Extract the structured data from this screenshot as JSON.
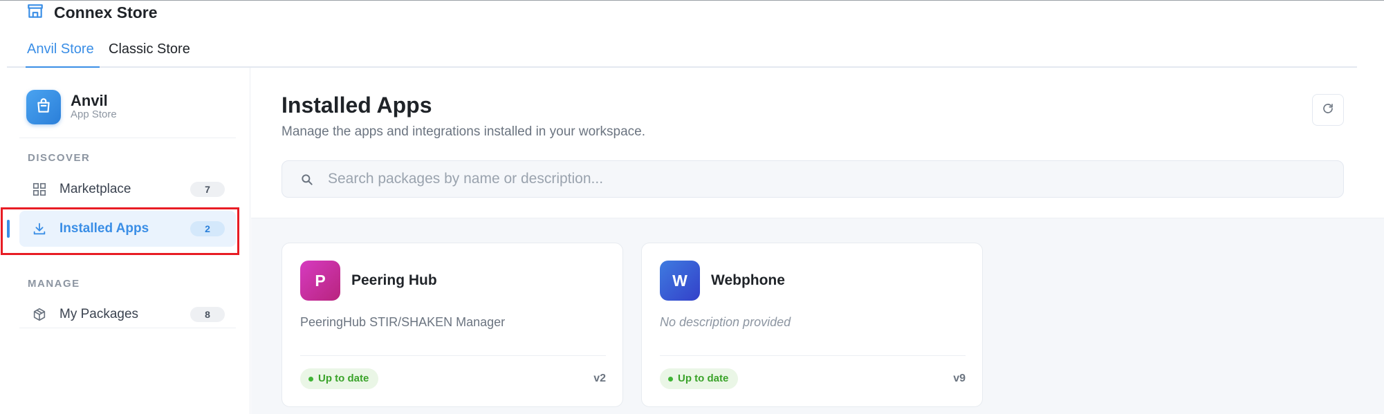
{
  "app": {
    "title": "Connex Store",
    "icon": "store-icon"
  },
  "tabs": [
    {
      "label": "Anvil Store",
      "active": true
    },
    {
      "label": "Classic Store",
      "active": false
    }
  ],
  "sidebar": {
    "brand": {
      "name": "Anvil",
      "subtitle": "App Store",
      "icon": "shopping-bag-icon"
    },
    "sections": [
      {
        "label": "DISCOVER",
        "items": [
          {
            "label": "Marketplace",
            "count": "7",
            "icon": "grid-icon",
            "active": false
          },
          {
            "label": "Installed Apps",
            "count": "2",
            "icon": "download-icon",
            "active": true
          }
        ]
      },
      {
        "label": "MANAGE",
        "items": [
          {
            "label": "My Packages",
            "count": "8",
            "icon": "package-icon",
            "active": false
          }
        ]
      }
    ]
  },
  "main": {
    "title": "Installed Apps",
    "subtitle": "Manage the apps and integrations installed in your workspace.",
    "refresh_icon": "refresh-icon",
    "search": {
      "placeholder": "Search packages by name or description...",
      "value": ""
    },
    "cards": [
      {
        "initial": "P",
        "name": "Peering Hub",
        "description": "PeeringHub STIR/SHAKEN Manager",
        "status": "Up to date",
        "version": "v2",
        "avatar_colors": [
          "#d63bc0",
          "#b8247e"
        ]
      },
      {
        "initial": "W",
        "name": "Webphone",
        "description": "No description provided",
        "status": "Up to date",
        "version": "v9",
        "avatar_colors": [
          "#3f7be0",
          "#3340c9"
        ]
      }
    ]
  },
  "colors": {
    "accent": "#3a8ee6",
    "highlight": "#e81c24",
    "status_green": "#3aa32a"
  }
}
